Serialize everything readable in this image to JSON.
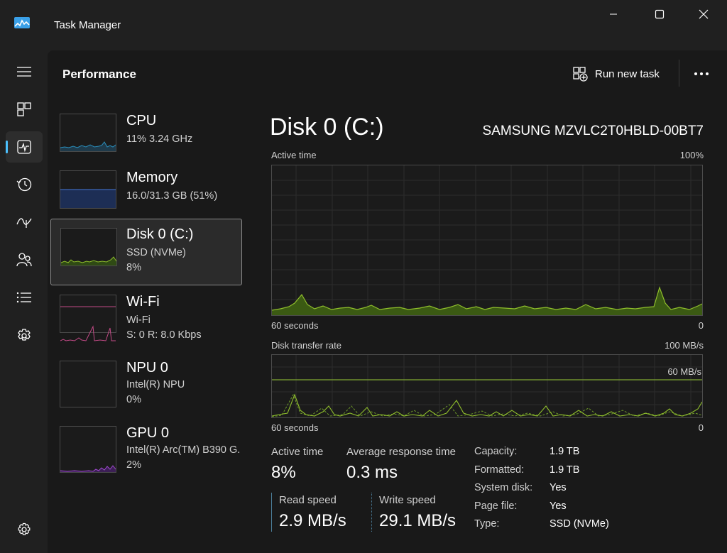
{
  "window": {
    "title": "Task Manager"
  },
  "header": {
    "title": "Performance",
    "run_task_label": "Run new task"
  },
  "nav": [
    "menu-icon",
    "processes-icon",
    "performance-icon",
    "app-history-icon",
    "startup-apps-icon",
    "users-icon",
    "details-icon",
    "services-icon",
    "settings-icon"
  ],
  "devices": [
    {
      "name": "CPU",
      "line1": "11%  3.24 GHz",
      "line2": ""
    },
    {
      "name": "Memory",
      "line1": "16.0/31.3 GB (51%)",
      "line2": ""
    },
    {
      "name": "Disk 0 (C:)",
      "line1": "SSD (NVMe)",
      "line2": "8%"
    },
    {
      "name": "Wi-Fi",
      "line1": "Wi-Fi",
      "line2": "S: 0  R: 8.0 Kbps"
    },
    {
      "name": "NPU 0",
      "line1": "Intel(R) NPU",
      "line2": "0%"
    },
    {
      "name": "GPU 0",
      "line1": "Intel(R) Arc(TM) B390 G.",
      "line2": "2%"
    }
  ],
  "detail": {
    "title": "Disk 0 (C:)",
    "model": "SAMSUNG MZVLC2T0HBLD-00BT7",
    "active_graph": {
      "label": "Active time",
      "max": "100%",
      "time": "60 seconds",
      "min": "0"
    },
    "transfer_graph": {
      "label": "Disk transfer rate",
      "max": "100 MB/s",
      "line_label": "60 MB/s",
      "time": "60 seconds",
      "min": "0"
    },
    "stats": {
      "active_time_label": "Active time",
      "active_time_value": "8%",
      "avg_response_label": "Average response time",
      "avg_response_value": "0.3 ms",
      "read_label": "Read speed",
      "read_value": "2.9 MB/s",
      "write_label": "Write speed",
      "write_value": "29.1 MB/s"
    },
    "info": [
      {
        "label": "Capacity:",
        "value": "1.9 TB"
      },
      {
        "label": "Formatted:",
        "value": "1.9 TB"
      },
      {
        "label": "System disk:",
        "value": "Yes"
      },
      {
        "label": "Page file:",
        "value": "Yes"
      },
      {
        "label": "Type:",
        "value": "SSD (NVMe)"
      }
    ]
  },
  "colors": {
    "disk_green": "#8fbe2c",
    "cpu_blue": "#2a8fbd",
    "memory_blue": "#3d66b8",
    "wifi_pink": "#c24a86",
    "gpu_purple": "#a04ad0",
    "accent": "#4cc2ff"
  }
}
